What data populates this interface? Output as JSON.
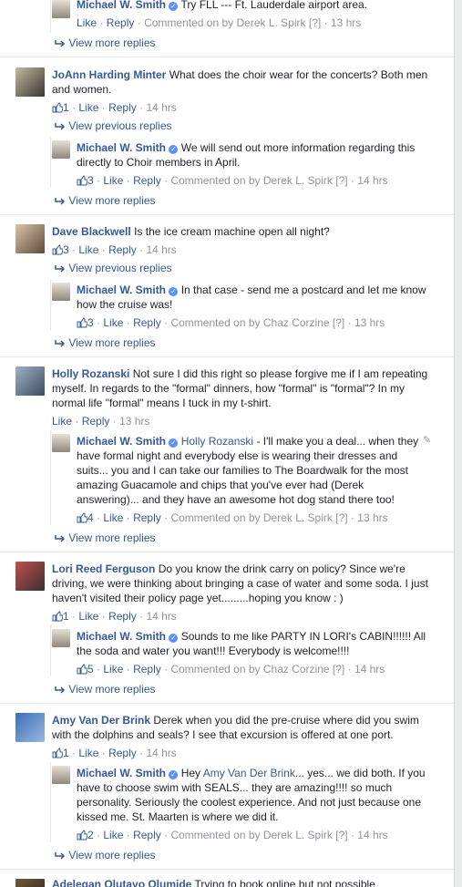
{
  "ui": {
    "like": "Like",
    "reply": "Reply",
    "sep": "·",
    "help": "[?]",
    "commented_on_by": "Commented on by"
  },
  "c0": {
    "reply": {
      "name": "Michael W. Smith",
      "text": "Try FLL --- Ft. Lauderdale airport area.",
      "by": "Derek L. Spirk",
      "time": "13 hrs"
    },
    "more": "View more replies"
  },
  "c1": {
    "name": "JoAnn Harding Minter",
    "text": "What does the choir wear for the concerts? Both men and women.",
    "likes": "1",
    "time": "14 hrs",
    "prev": "View previous replies",
    "reply": {
      "name": "Michael W. Smith",
      "text": "We will send out more information regarding this directly to Choir members in April.",
      "likes": "3",
      "by": "Derek L. Spirk",
      "time": "14 hrs"
    },
    "more": "View more replies"
  },
  "c2": {
    "name": "Dave Blackwell",
    "text": "Is the ice cream machine open all night?",
    "likes": "3",
    "time": "14 hrs",
    "prev": "View previous replies",
    "reply": {
      "name": "Michael W. Smith",
      "text": "In that case - send me a postcard and let me know how the cruise was!",
      "likes": "3",
      "by": "Chaz Corzine",
      "time": "13 hrs"
    },
    "more": "View more replies"
  },
  "c3": {
    "name": "Holly Rozanski",
    "text": "Not sure I did this right so please forgive me if I am repeating myself. In regards to the \"formal\" dinners, how \"formal\" is \"formal\"? In my normal life \"formal\" means I tuck in my t-shirt.",
    "time": "13 hrs",
    "reply": {
      "name": "Michael W. Smith",
      "mention": "Holly Rozanski",
      "text": "- I'll make you a deal... when they have formal night and everybody else is wearing their dresses and suits... you and I can take our families to The Boardwalk for the most amazing Guacamole and chips that you've ever had (Derek answering)... and they have an awesome hot dog stand there too!",
      "likes": "4",
      "by": "Derek L. Spirk",
      "time": "13 hrs"
    },
    "more": "View more replies"
  },
  "c4": {
    "name": "Lori Reed Ferguson",
    "text": "Do you know the drink carry on policy? Since we're driving, we were thinking about bringing a case of water and some soda. I just haven't visited their policy page yet.........hoping you know : )",
    "likes": "1",
    "time": "14 hrs",
    "reply": {
      "name": "Michael W. Smith",
      "text": "Sounds to me like PARTY IN LORI's CABIN!!!!!! All the soda and water you want!!! Everybody is welcome!!!!",
      "likes": "5",
      "by": "Chaz Corzine",
      "time": "14 hrs"
    },
    "more": "View more replies"
  },
  "c5": {
    "name": "Amy Van Der Brink",
    "text": "Derek when you did the pre-cruise where did you swim with the dolphins and seals? I see that excursion is offered at one port.",
    "likes": "1",
    "time": "14 hrs",
    "reply": {
      "name": "Michael W. Smith",
      "pre": "Hey",
      "mention": "Amy Van Der Brink",
      "text": "... yes... we did both. If you have to choose swim with SEALS... they are amazing!!!! so much personality. Seriously the coolest experience. And not just because one kissed me. St. Maarten is where we did it.",
      "likes": "2",
      "by": "Derek L. Spirk",
      "time": "14 hrs"
    },
    "more": "View more replies"
  },
  "c6": {
    "name": "Adelegan Olutayo Olumide",
    "text": "Trying to book online but not possible"
  },
  "colors": {
    "link": "#365899",
    "meta": "#90949c",
    "text": "#1d2129",
    "verified": "#5890ff"
  }
}
